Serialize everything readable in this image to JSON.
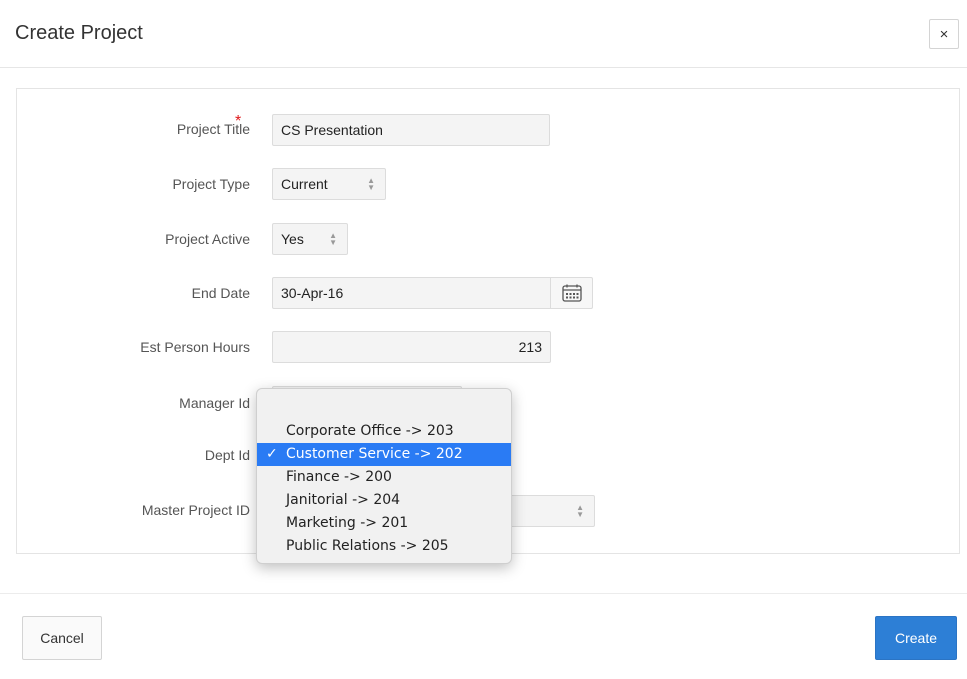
{
  "dialog": {
    "title": "Create Project",
    "close_label": "×"
  },
  "form": {
    "project_title": {
      "label": "Project Title",
      "required_marker": "*",
      "value": "CS Presentation"
    },
    "project_type": {
      "label": "Project Type",
      "value": "Current"
    },
    "project_active": {
      "label": "Project Active",
      "value": "Yes"
    },
    "end_date": {
      "label": "End Date",
      "value": "30-Apr-16",
      "icon": "calendar-icon"
    },
    "est_person_hours": {
      "label": "Est Person Hours",
      "value": "213"
    },
    "manager_id": {
      "label": "Manager Id"
    },
    "dept_id": {
      "label": "Dept Id"
    },
    "master_project_id": {
      "label": "Master Project ID"
    }
  },
  "dept_dropdown": {
    "check_mark": "✓",
    "options": [
      "Corporate Office -> 203",
      "Customer Service -> 202",
      "Finance -> 200",
      "Janitorial -> 204",
      "Marketing -> 201",
      "Public Relations -> 205"
    ],
    "selected": "Customer Service -> 202"
  },
  "footer": {
    "cancel_label": "Cancel",
    "create_label": "Create"
  },
  "colors": {
    "primary": "#2d7fd6",
    "selection": "#2a7bf4",
    "required": "#e0181a"
  }
}
